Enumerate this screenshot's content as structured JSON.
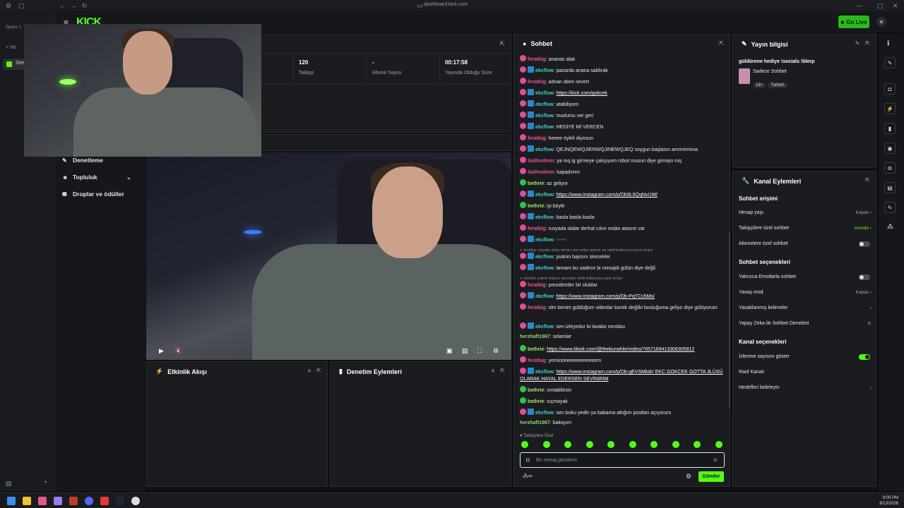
{
  "browser": {
    "url": "dashboard.kick.com",
    "space_label": "Space 1",
    "new_tab_label": "Ne",
    "active_tab_label": "Stre"
  },
  "header": {
    "logo_text": "KICK",
    "golive_label": "Go Live"
  },
  "nav": {
    "items": [
      {
        "label": "Denetleme",
        "icon": "shield-icon"
      },
      {
        "label": "Topluluk",
        "icon": "people-icon"
      },
      {
        "label": "Droplar ve ödüller",
        "icon": "gift-icon"
      }
    ]
  },
  "stats": [
    {
      "value": "120",
      "label": "Takipçi"
    },
    {
      "value": "-",
      "label": "Abone Sayısı"
    },
    {
      "value": "00:17:58",
      "label": "Yayında Olduğu Süre"
    }
  ],
  "panels": {
    "activity_title": "Etkinlik Akışı",
    "moderation_title": "Denetim Eylemleri",
    "chat_title": "Sohbet",
    "stream_info_title": "Yayın bilgisi",
    "channel_actions_title": "Kanal Eylemleri"
  },
  "chat": {
    "messages": [
      {
        "user": "feratbig",
        "text": "ananas alak"
      },
      {
        "user": "ekcflow",
        "text": "pazarda anana saldırak"
      },
      {
        "user": "feratbig",
        "text": "adnan abim severt"
      },
      {
        "user": "ekcflow",
        "text": "https://kick.com/gokcek"
      },
      {
        "user": "ekcflow",
        "text": "atabiliyom"
      },
      {
        "user": "ekcflow",
        "text": "modumu ver geri"
      },
      {
        "user": "ekcflow",
        "text": "HEDİYE Mİ VERCEN"
      },
      {
        "user": "feratbig",
        "text": "heeee öyleli diyosun"
      },
      {
        "user": "ekcflow",
        "text": "QEJNQEWQJIENWQJINEWQJEQ soygun başlasın ammmmına"
      },
      {
        "user": "Salihxdmm",
        "text": "ya mq ig girmeye çalışıyom robot musun diye girmiyo mq"
      },
      {
        "user": "Salihxdmm",
        "text": "kapadımm"
      },
      {
        "user": "bethrie",
        "text": "az geliyor"
      },
      {
        "user": "ekcflow",
        "text": "https://www.instagram.com/p/Db9L6QqNvUW/"
      },
      {
        "user": "bethrie",
        "text": "iyi böyle"
      },
      {
        "user": "ekcflow",
        "text": "basla basla basla"
      },
      {
        "user": "feratbig",
        "text": "rusyada olalar derhal cıkın ordan atasım var"
      },
      {
        "user": "ekcflow",
        "text": ""
      },
      {
        "user": "ekcflow",
        "text": "putinin bajısını skecekler"
      },
      {
        "user": "ekcflow",
        "text": "tamam bu sadece bi mesajdı gülün diye değil."
      },
      {
        "user": "feratbig",
        "text": "prezidentler bir olublar"
      },
      {
        "user": "ekcflow",
        "text": "https://www.instagram.com/p/Db-PqTCs5Ms/"
      },
      {
        "user": "feratbig",
        "text": "olm benim güldüğüm videolar komik değilki bosluğuma geliyo diye gülüyorum"
      },
      {
        "user": "ekcflow",
        "text": "sen izleyedur bi lavabo omolası"
      },
      {
        "user": "herzhaft1967",
        "text": "selamlar"
      },
      {
        "user": "bethrie",
        "text": "https://www.tiktok.com/@theburwhite/video/7657189413306305812"
      },
      {
        "user": "feratbig",
        "text": "yemiceeeeeeeeeeeeem"
      },
      {
        "user": "ekcflow",
        "text": "https://www.instagram.com/p/Db-gEVSMkdr/ EKC GOKCEK GOTTA 3LÜSÜ OLARAK HAYAL EDERSEN SEVİNİRİM"
      },
      {
        "user": "bethrie",
        "text": "sıntabilirsin"
      },
      {
        "user": "bethrie",
        "text": "sıçmayak"
      },
      {
        "user": "ekcflow",
        "text": "sen boku yedin ya babama attığım postları açıyorum"
      },
      {
        "user": "herzhaft1967",
        "text": "bakayım"
      }
    ],
    "reply1": "feratbig: rusyada olalar derhal cıkın ordan atasım var isimli kullanıcıya yanıt veriyor",
    "reply2": "ekcflow: putinin bajısını skecekler isimli kullanıcıya yanıt veriyor",
    "followers_only": "Takipçilere Özel",
    "input_placeholder": "Bir mesaj gönderin",
    "send_label": "Gönder"
  },
  "stream_info": {
    "title": "güldürene hediye !socials !blerp",
    "category": "Sadece Sohbet",
    "tags": [
      "18+",
      "Turkish"
    ]
  },
  "channel_actions": {
    "chat_access_title": "Sohbet erişimi",
    "account_age": {
      "label": "Hesap yaşı",
      "value": "Kapalı"
    },
    "followers_chat": {
      "label": "Takipçilere özel sohbet",
      "value": "Anında"
    },
    "subscribers_chat": {
      "label": "Abonelere özel sohbet"
    },
    "chat_options_title": "Sohbet seçenekleri",
    "emotes_only": {
      "label": "Yalnızca Emotlarla sohbet"
    },
    "slow_mode": {
      "label": "Yavaş mod",
      "value": "Kapalı"
    },
    "banned_words": {
      "label": "Yasaklanmış kelimeler"
    },
    "ai_moderation": {
      "label": "Yapay Zeka ile Sohbet Denetimi"
    },
    "channel_options_title": "Kanal seçenekleri",
    "show_viewers": {
      "label": "İzlenme sayısını göster"
    },
    "raid": {
      "label": "Raid Kanalı"
    },
    "goals": {
      "label": "Hedefleri belirleyin"
    }
  },
  "clock": {
    "time": "9:09 PM",
    "date": "8/13/2026"
  },
  "colors": {
    "accent": "#53fc18",
    "panel": "#1b1c20"
  }
}
